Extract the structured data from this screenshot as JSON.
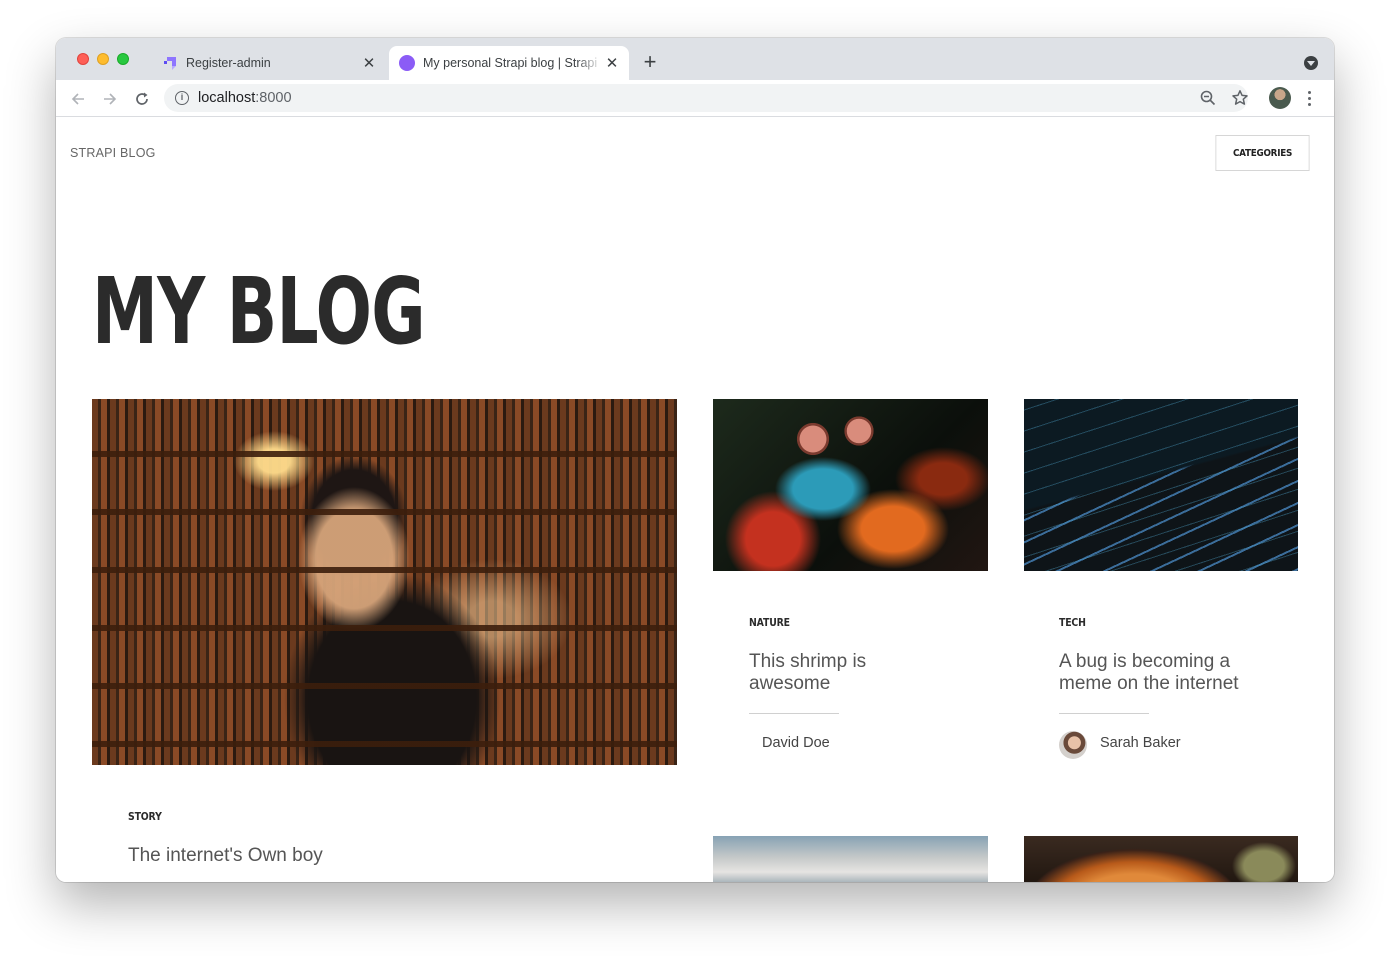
{
  "browser": {
    "tabs": [
      {
        "title": "Register-admin",
        "active": false,
        "favicon": "strapi-logo-icon"
      },
      {
        "title": "My personal Strapi blog | Strapi",
        "active": true,
        "favicon": "purple-circle-icon"
      }
    ],
    "new_tab_label": "+",
    "url_host": "localhost",
    "url_port": ":8000",
    "close_glyph": "✕"
  },
  "site": {
    "brand": "STRAPI BLOG",
    "categories_button": "CATEGORIES",
    "hero_title": "MY BLOG"
  },
  "articles": [
    {
      "category": "STORY",
      "title": "The internet's Own boy",
      "author": "",
      "image": "man-reading-in-library"
    },
    {
      "category": "NATURE",
      "title": "This shrimp is awesome",
      "author": "David Doe",
      "image": "mantis-shrimp"
    },
    {
      "category": "TECH",
      "title": "A bug is becoming a meme on the internet",
      "author": "Sarah Baker",
      "image": "laptop-code"
    },
    {
      "category": "",
      "title": "",
      "author": "",
      "image": "sky-landscape"
    },
    {
      "category": "",
      "title": "",
      "author": "",
      "image": "pizza"
    }
  ],
  "colors": {
    "accent_purple": "#8b5cf6",
    "tabstrip": "#dee1e6",
    "heading": "#2b2b2b"
  }
}
